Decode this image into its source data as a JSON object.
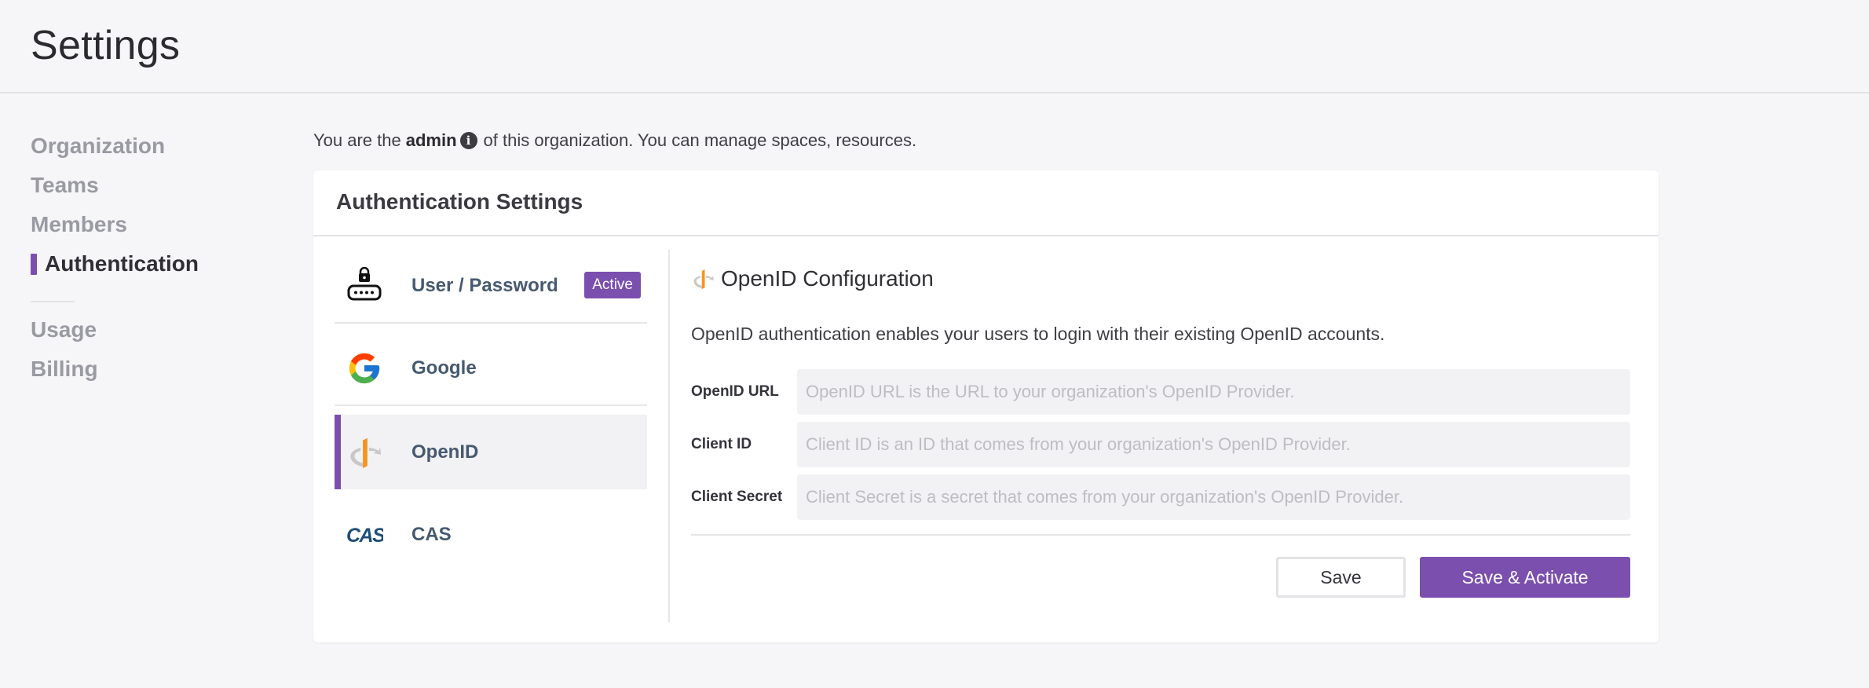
{
  "header": {
    "title": "Settings"
  },
  "sidebar": {
    "items": [
      {
        "label": "Organization"
      },
      {
        "label": "Teams"
      },
      {
        "label": "Members"
      },
      {
        "label": "Authentication",
        "active": true
      }
    ],
    "secondary": [
      {
        "label": "Usage"
      },
      {
        "label": "Billing"
      }
    ]
  },
  "role": {
    "prefix": "You are the",
    "role_name": "admin",
    "suffix": "of this organization. You can manage spaces, resources."
  },
  "auth": {
    "title": "Authentication Settings",
    "providers": [
      {
        "label": "User / Password",
        "icon": "lock-keyboard-icon",
        "badge": "Active"
      },
      {
        "label": "Google",
        "icon": "google-icon"
      },
      {
        "label": "OpenID",
        "icon": "openid-icon",
        "selected": true
      },
      {
        "label": "CAS",
        "icon": "cas-icon"
      }
    ],
    "config": {
      "title": "OpenID Configuration",
      "description": "OpenID authentication enables your users to login with their existing OpenID accounts.",
      "fields": [
        {
          "label": "OpenID URL",
          "value": "",
          "placeholder": "OpenID URL is the URL to your organization's OpenID Provider."
        },
        {
          "label": "Client ID",
          "value": "",
          "placeholder": "Client ID is an ID that comes from your organization's OpenID Provider."
        },
        {
          "label": "Client Secret",
          "value": "",
          "placeholder": "Client Secret is a secret that comes from your organization's OpenID Provider."
        }
      ],
      "save_label": "Save",
      "activate_label": "Save & Activate"
    }
  },
  "colors": {
    "accent": "#7b4fae",
    "provider_text": "#46596f"
  }
}
